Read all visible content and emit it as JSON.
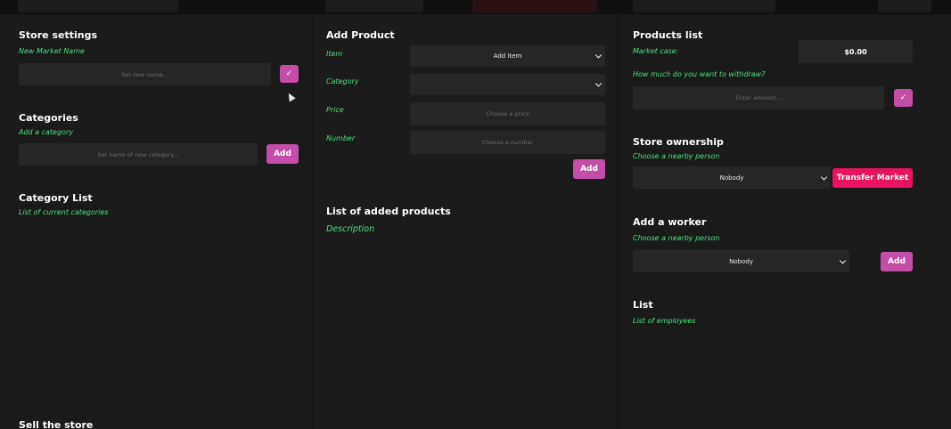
{
  "store_settings": {
    "title": "Store settings",
    "subtitle": "New Market Name",
    "name_placeholder": "Set new name...",
    "confirm_glyph": "✓"
  },
  "categories": {
    "title": "Categories",
    "subtitle": "Add a category",
    "name_placeholder": "Set name of new category...",
    "add_label": "Add"
  },
  "category_list": {
    "title": "Category List",
    "subtitle": "List of current categories"
  },
  "sell_store": {
    "title": "Sell the store"
  },
  "add_product": {
    "title": "Add Product",
    "item_label": "Item",
    "item_value": "Add item",
    "category_label": "Category",
    "category_value": "",
    "price_label": "Price",
    "price_placeholder": "Choose a price",
    "number_label": "Number",
    "number_placeholder": "Choose a number",
    "add_label": "Add"
  },
  "added_products": {
    "title": "List of added products",
    "description": "Description"
  },
  "products_list": {
    "title": "Products list",
    "market_case_label": "Market case:",
    "market_case_value": "$0.00",
    "withdraw_question": "How much do you want to withdraw?",
    "amount_placeholder": "Enter amount...",
    "confirm_glyph": "✓"
  },
  "ownership": {
    "title": "Store ownership",
    "subtitle": "Choose a nearby person",
    "person_value": "Nobody",
    "transfer_label": "Transfer Market"
  },
  "worker": {
    "title": "Add a worker",
    "subtitle": "Choose a nearby person",
    "person_value": "Nobody",
    "add_label": "Add"
  },
  "employees": {
    "title": "List",
    "subtitle": "List of employees"
  },
  "colors": {
    "accent_pink": "#c34ea8",
    "accent_red": "#e8135e",
    "label_green": "#4fe07e",
    "panel_bg": "#1a1a1a",
    "field_bg": "#262626"
  }
}
